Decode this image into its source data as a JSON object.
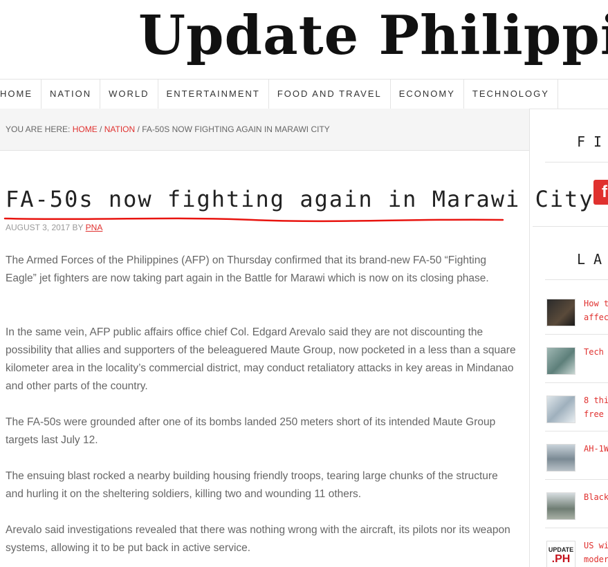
{
  "site": {
    "title": "Update Philippines"
  },
  "nav": {
    "items": [
      {
        "label": "HOME"
      },
      {
        "label": "NATION"
      },
      {
        "label": "WORLD"
      },
      {
        "label": "ENTERTAINMENT"
      },
      {
        "label": "FOOD AND TRAVEL"
      },
      {
        "label": "ECONOMY"
      },
      {
        "label": "TECHNOLOGY"
      }
    ]
  },
  "breadcrumb": {
    "prefix": "YOU ARE HERE:",
    "home": "HOME",
    "sep1": "/",
    "section": "NATION",
    "sep2": "/",
    "current": "FA-50S NOW FIGHTING AGAIN IN MARAWI CITY"
  },
  "article": {
    "title": "FA-50s now fighting again in Marawi City",
    "date": "AUGUST 3, 2017",
    "by": "BY",
    "author": "PNA",
    "paragraphs": [
      "The Armed Forces of the Philippines (AFP) on Thursday confirmed that its brand-new FA-50 “Fighting Eagle” jet fighters are now taking part again in the Battle for Marawi which is now on its closing phase.",
      "In the same vein, AFP public affairs office chief Col. Edgard Arevalo said they are not discounting the possibility that allies and supporters of the beleaguered Maute Group, now pocketed in a less than a square kilometer area in the locality’s commercial district, may conduct retaliatory attacks in key areas in Mindanao and other parts of the country.",
      "The FA-50s were grounded after one of its bombs landed 250 meters short of its intended Maute Group targets last July 12.",
      "The ensuing blast rocked a nearby building housing friendly troops, tearing large chunks of the structure and hurling it on the sheltering soldiers, killing two and wounding 11 others.",
      "Arevalo said investigations revealed that there was nothing wrong with the aircraft, its pilots nor its weapon systems, allowing it to be put back in active service."
    ]
  },
  "sidebar": {
    "find_title": "FIN",
    "fb_glyph": "f",
    "latest_title": "LA",
    "posts": [
      {
        "line1": "How t",
        "line2": "affec"
      },
      {
        "line1": "Tech",
        "line2": ""
      },
      {
        "line1": "8 thi",
        "line2": "free"
      },
      {
        "line1": "AH-1W",
        "line2": ""
      },
      {
        "line1": "Black",
        "line2": ""
      },
      {
        "line1": "US wi",
        "line2": "moder"
      }
    ],
    "thumb_logo": {
      "line1": "UPDATE",
      "line2": ".PH"
    }
  },
  "colors": {
    "accent": "#e0312f",
    "text": "#666666",
    "border": "#e3e3e3"
  }
}
